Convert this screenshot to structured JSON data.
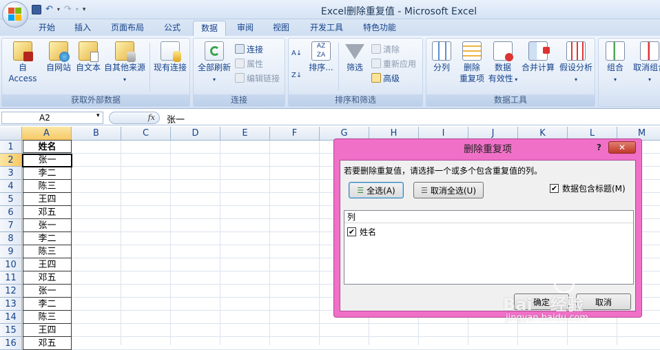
{
  "window": {
    "title": "Excel删除重复值 - Microsoft Excel"
  },
  "tabs": [
    "开始",
    "插入",
    "页面布局",
    "公式",
    "数据",
    "审阅",
    "视图",
    "开发工具",
    "特色功能"
  ],
  "active_tab": "数据",
  "ribbon": {
    "groups": [
      {
        "label": "获取外部数据"
      },
      {
        "label": "连接"
      },
      {
        "label": "排序和筛选"
      },
      {
        "label": "数据工具"
      }
    ],
    "get_external": {
      "access": "自 Access",
      "web": "自网站",
      "text": "自文本",
      "other": "自其他来源",
      "existing": "现有连接"
    },
    "connections": {
      "refresh_all": "全部刷新",
      "connections": "连接",
      "properties": "属性",
      "edit_links": "编辑链接"
    },
    "sort_filter": {
      "sort": "排序...",
      "filter": "筛选",
      "clear": "清除",
      "reapply": "重新应用",
      "advanced": "高级"
    },
    "data_tools": {
      "text_to_columns": "分列",
      "remove_dup_line1": "删除",
      "remove_dup_line2": "重复项",
      "validation_line1": "数据",
      "validation_line2": "有效性",
      "consolidate": "合并计算",
      "whatif": "假设分析"
    },
    "outline": {
      "group": "组合",
      "ungroup": "取消组合"
    }
  },
  "formula_bar": {
    "name_box": "A2",
    "fx": "fx",
    "content": "张一"
  },
  "sheet": {
    "columns": [
      "A",
      "B",
      "C",
      "D",
      "E",
      "F",
      "G",
      "H",
      "I",
      "J",
      "K",
      "L",
      "M"
    ],
    "rows": [
      "1",
      "2",
      "3",
      "4",
      "5",
      "6",
      "7",
      "8",
      "9",
      "10",
      "11",
      "12",
      "13",
      "14",
      "15",
      "16"
    ],
    "colA": [
      "姓名",
      "张一",
      "李二",
      "陈三",
      "王四",
      "邓五",
      "张一",
      "李二",
      "陈三",
      "王四",
      "邓五",
      "张一",
      "李二",
      "陈三",
      "王四",
      "邓五"
    ]
  },
  "dialog": {
    "title": "删除重复项",
    "help": "?",
    "close": "✕",
    "message": "若要删除重复值，请选择一个或多个包含重复值的列。",
    "select_all": "全选(A)",
    "unselect_all": "取消全选(U)",
    "has_headers": "数据包含标题(M)",
    "has_headers_checked": true,
    "list_header": "列",
    "items": [
      {
        "label": "姓名",
        "checked": true
      }
    ],
    "ok": "确定",
    "cancel": "取消"
  },
  "watermark": {
    "text1": "Bai",
    "text2": "经验",
    "url": "jingyan.baidu.com"
  },
  "colors": {
    "dialog_frame": "#f070c8",
    "ribbon_text": "#15428b",
    "selected_header": "#f7c865"
  }
}
